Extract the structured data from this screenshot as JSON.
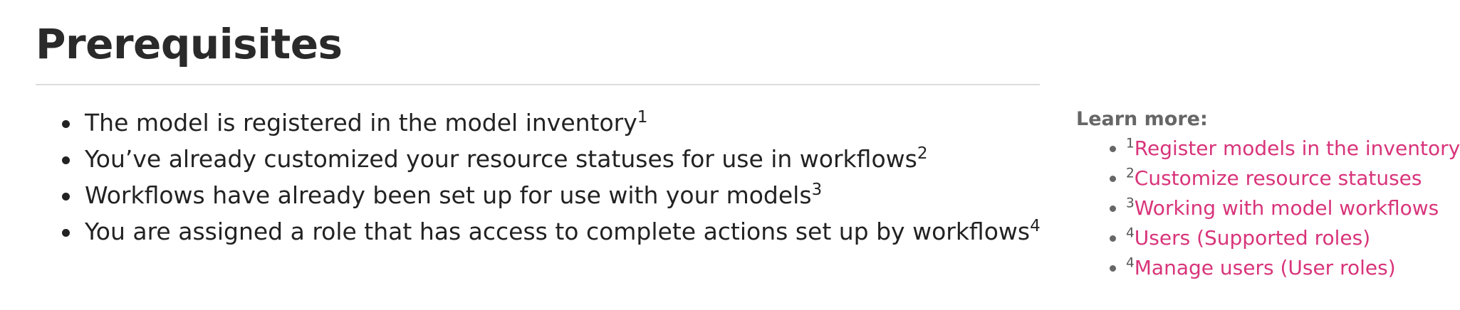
{
  "page": {
    "title": "Prerequisites"
  },
  "prerequisites": [
    {
      "text": "The model is registered in the model inventory",
      "ref": "1"
    },
    {
      "text": "You’ve already customized your resource statuses for use in workflows",
      "ref": "2"
    },
    {
      "text": "Workflows have already been set up for use with your models",
      "ref": "3"
    },
    {
      "text": "You are assigned a role that has access to complete actions set up by workflows",
      "ref": "4"
    }
  ],
  "learn_more": {
    "heading": "Learn more:",
    "links": [
      {
        "ref": "1",
        "label": "Register models in the inventory"
      },
      {
        "ref": "2",
        "label": "Customize resource statuses"
      },
      {
        "ref": "3",
        "label": "Working with model workflows"
      },
      {
        "ref": "4",
        "label": "Users (Supported roles)"
      },
      {
        "ref": "4",
        "label": "Manage users (User roles)"
      }
    ]
  },
  "colors": {
    "link": "#d8347a",
    "text": "#222222",
    "muted": "#666666",
    "rule": "#dcdcdc"
  }
}
